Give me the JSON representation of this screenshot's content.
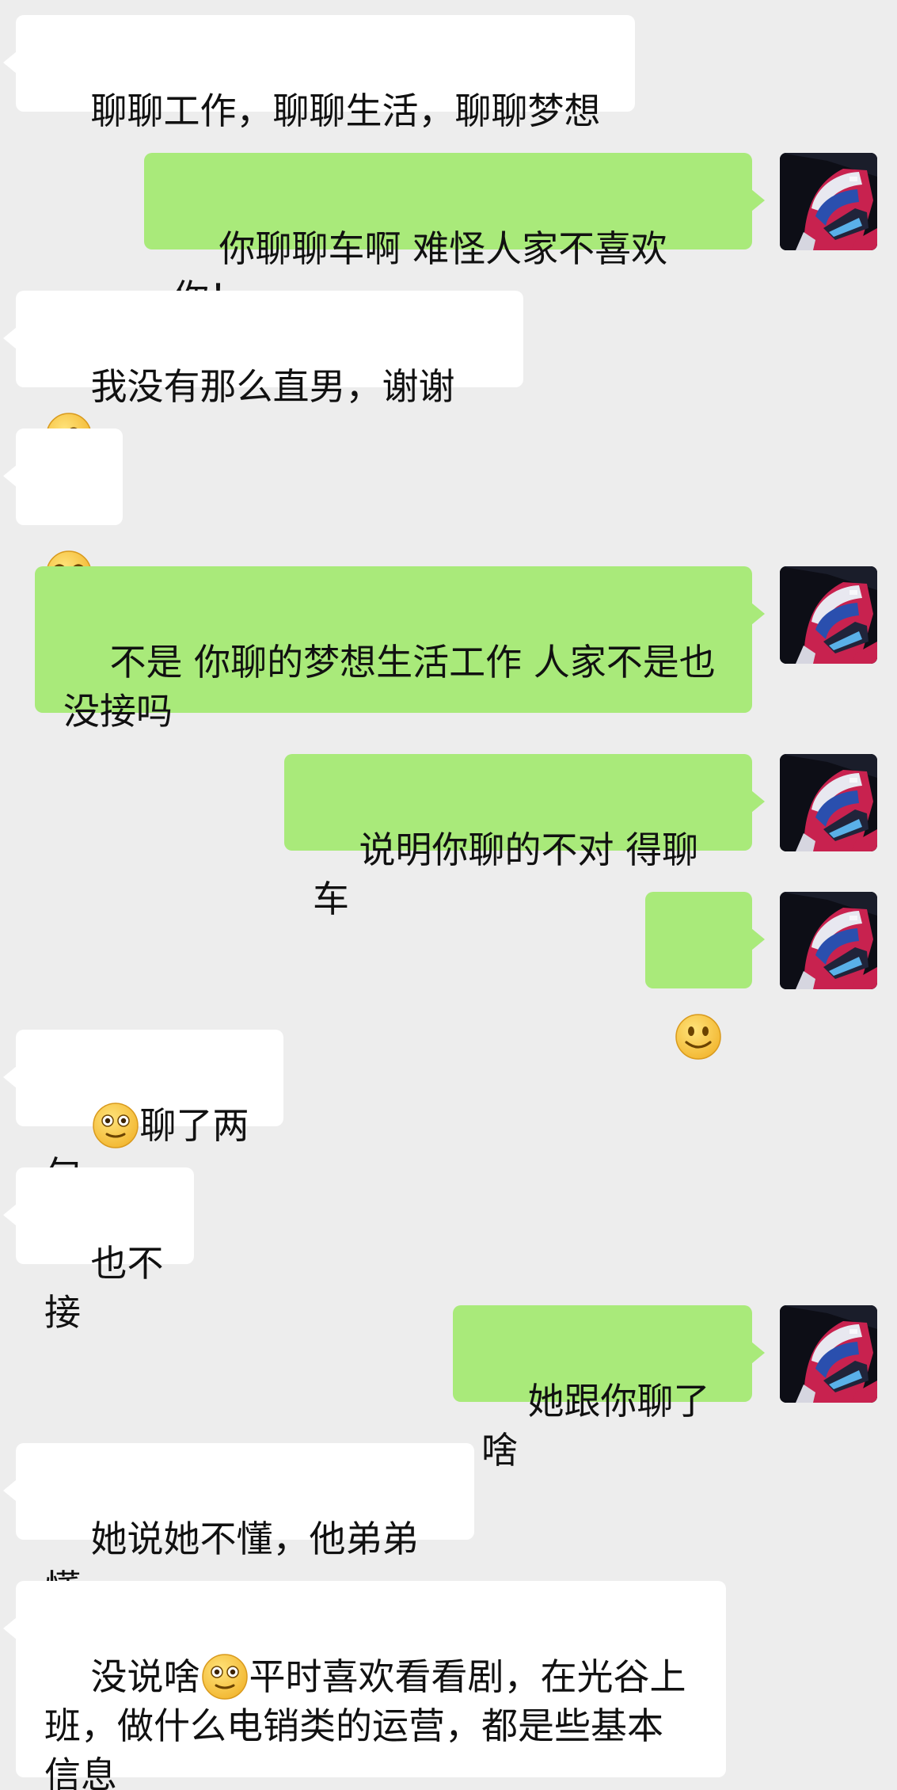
{
  "messages": [
    {
      "side": "in",
      "text": "聊聊工作，聊聊生活，聊聊梦想"
    },
    {
      "side": "out",
      "text": "你聊聊车啊 难怪人家不喜欢你！"
    },
    {
      "side": "in",
      "text": "我没有那么直男，谢谢",
      "emoji_after": "facepalm-emoji"
    },
    {
      "side": "in",
      "emoji_only": "laughing-tears-emoji"
    },
    {
      "side": "out",
      "text": "不是 你聊的梦想生活工作 人家不是也没接吗"
    },
    {
      "side": "out",
      "text": "说明你聊的不对 得聊车"
    },
    {
      "side": "out",
      "emoji_only": "smile-emoji"
    },
    {
      "side": "in",
      "emoji_before": "awkward-smile-emoji",
      "text": "聊了两句"
    },
    {
      "side": "in",
      "text": "也不接"
    },
    {
      "side": "out",
      "text": "她跟你聊了啥"
    },
    {
      "side": "in",
      "text": "她说她不懂，他弟弟懂"
    },
    {
      "side": "in",
      "text_before": "没说啥",
      "emoji_mid": "awkward-smile-emoji",
      "text": "平时喜欢看看剧，在光谷上班，做什么电销类的运营，都是些基本信息"
    }
  ],
  "colors": {
    "background": "#ededed",
    "incoming_bubble": "#ffffff",
    "outgoing_bubble": "#a9ea7a",
    "text": "#111111"
  },
  "avatar": {
    "icon": "racing-helmet-avatar"
  }
}
